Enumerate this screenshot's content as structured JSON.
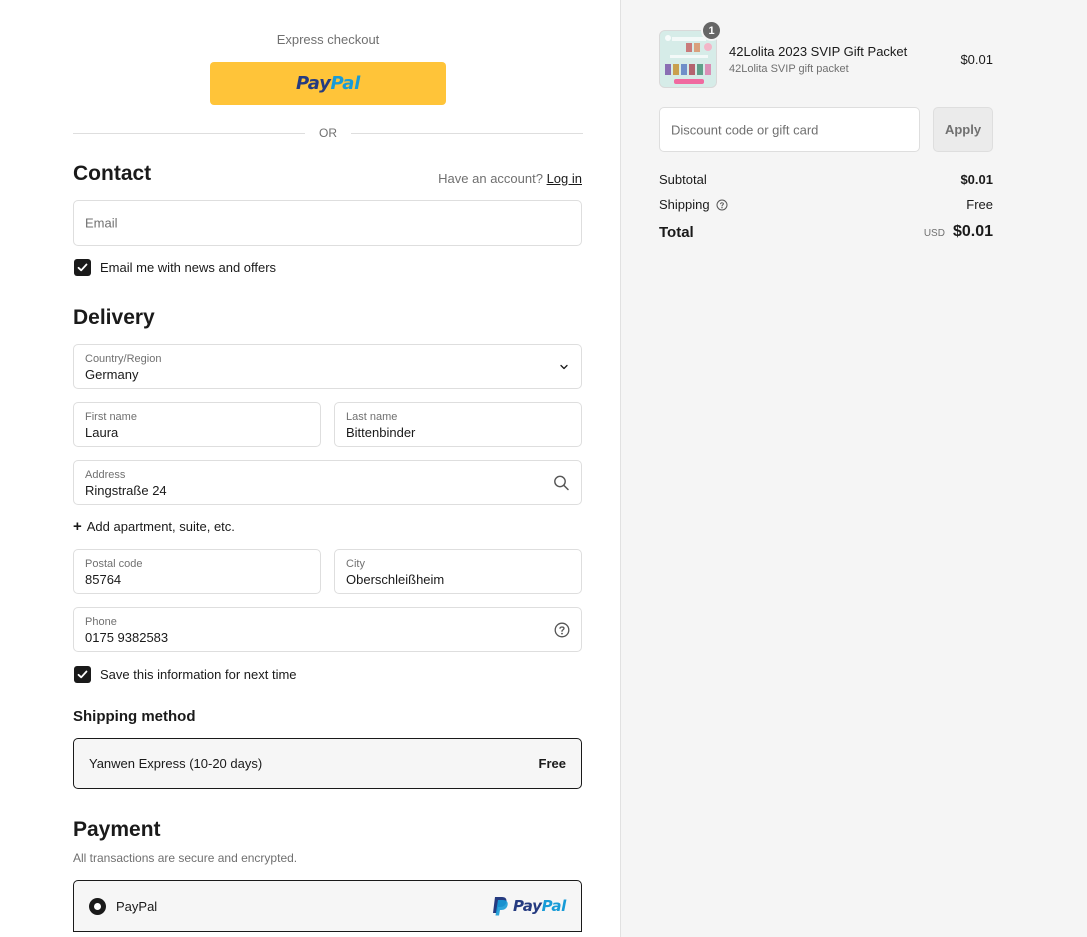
{
  "express": {
    "label": "Express checkout",
    "paypal_left": "Pay",
    "paypal_right": "Pal"
  },
  "divider": {
    "text": "OR"
  },
  "contact": {
    "title": "Contact",
    "account_prompt": "Have an account?",
    "login_link": "Log in",
    "email_placeholder": "Email",
    "newsletter_label": "Email me with news and offers",
    "newsletter_checked": true
  },
  "delivery": {
    "title": "Delivery",
    "country": {
      "label": "Country/Region",
      "value": "Germany"
    },
    "first_name": {
      "label": "First name",
      "value": "Laura"
    },
    "last_name": {
      "label": "Last name",
      "value": "Bittenbinder"
    },
    "address": {
      "label": "Address",
      "value": "Ringstraße 24"
    },
    "add_apartment": "Add apartment, suite, etc.",
    "postal": {
      "label": "Postal code",
      "value": "85764"
    },
    "city": {
      "label": "City",
      "value": "Oberschleißheim"
    },
    "phone": {
      "label": "Phone",
      "value": "0175 9382583"
    },
    "save_info_label": "Save this information for next time",
    "save_info_checked": true
  },
  "shipping": {
    "title": "Shipping method",
    "option_name": "Yanwen Express (10-20 days)",
    "option_price": "Free"
  },
  "payment": {
    "title": "Payment",
    "subtitle": "All transactions are secure and encrypted.",
    "method_label": "PayPal",
    "logo_left": "Pay",
    "logo_right": "Pal"
  },
  "order": {
    "item": {
      "quantity": "1",
      "name": "42Lolita 2023 SVIP Gift Packet",
      "variant": "42Lolita SVIP gift packet",
      "price": "$0.01"
    },
    "discount_placeholder": "Discount code or gift card",
    "apply_label": "Apply",
    "subtotal_label": "Subtotal",
    "subtotal_value": "$0.01",
    "shipping_label": "Shipping",
    "shipping_value": "Free",
    "total_label": "Total",
    "currency": "USD",
    "total_value": "$0.01"
  },
  "colors": {
    "paypal_yellow": "#ffc439",
    "paypal_dark": "#253b80",
    "paypal_light": "#179bd7",
    "sidebar_bg": "#f5f5f5",
    "text": "#1a1a1a",
    "muted": "#707070"
  }
}
